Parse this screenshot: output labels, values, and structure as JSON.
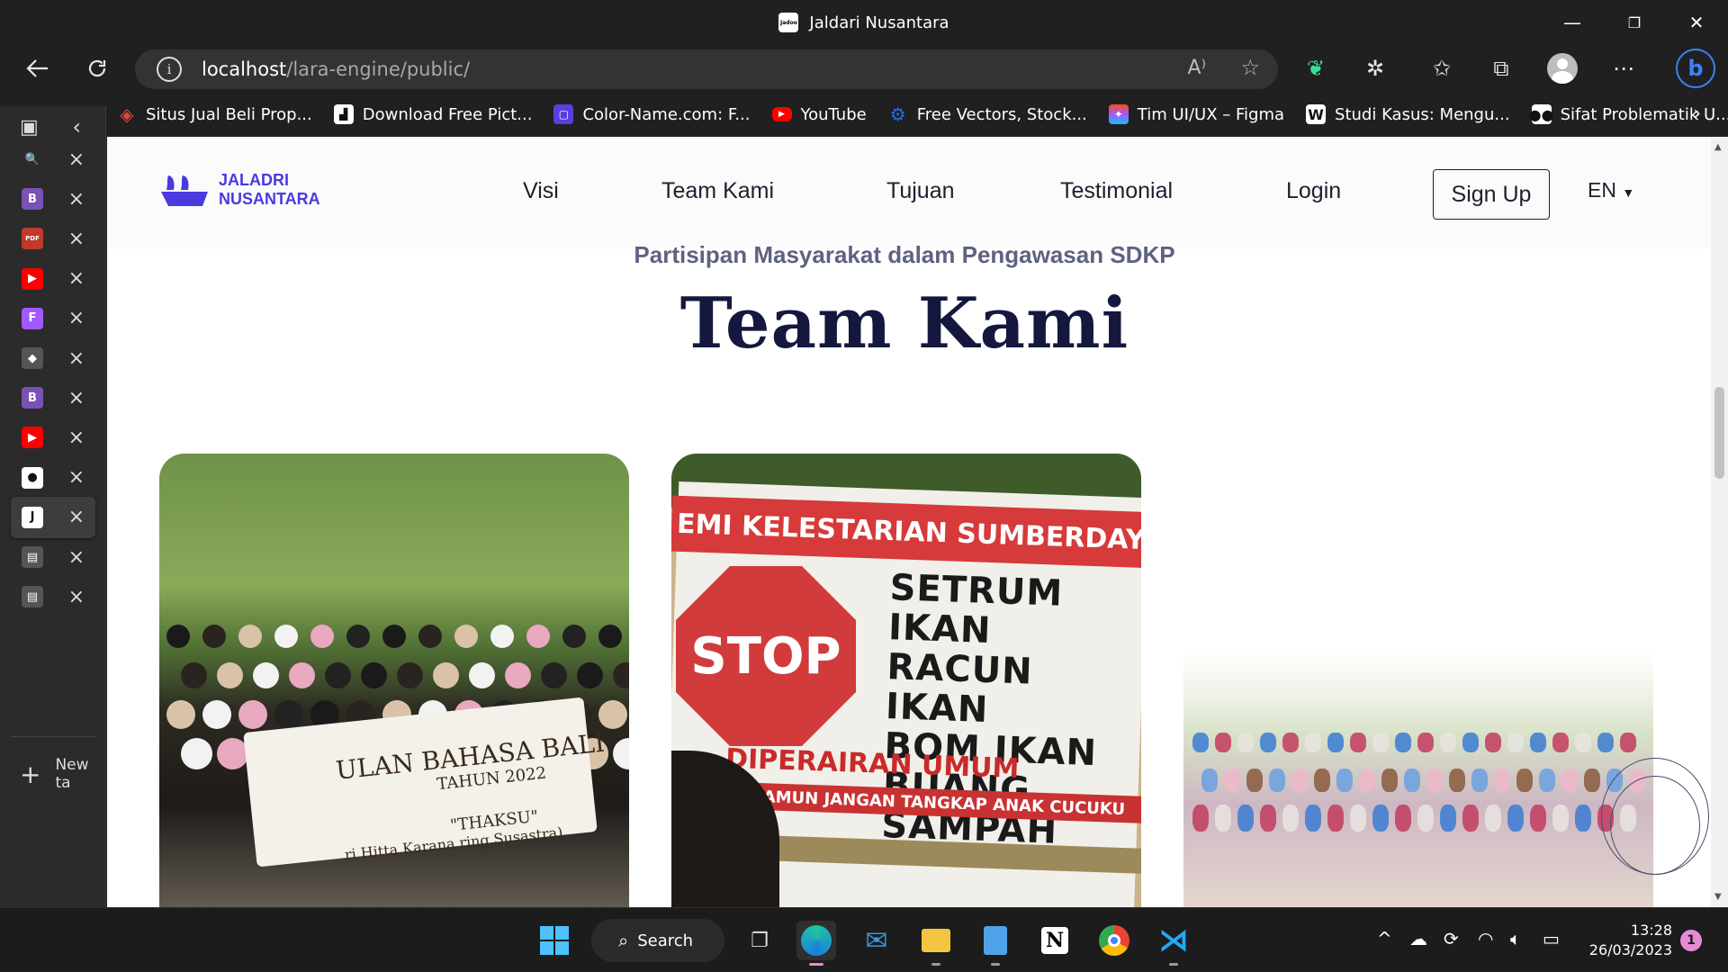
{
  "window": {
    "title": "Jaldari Nusantara",
    "favicon_text": "Jadoo",
    "minimize": "—",
    "maximize": "❐",
    "close": "✕"
  },
  "address_bar": {
    "host": "localhost",
    "path": "/lara-engine/public/"
  },
  "bookmarks": [
    {
      "label": "Situs Jual Beli Prop...",
      "color": "#e2453c",
      "icon": "diamond-icon"
    },
    {
      "label": "Download Free Pict...",
      "color": "#111111",
      "icon": "photo-icon"
    },
    {
      "label": "Color-Name.com: F...",
      "color": "#5b3de0",
      "icon": "square-icon"
    },
    {
      "label": "YouTube",
      "color": "#ff0000",
      "icon": "youtube-icon"
    },
    {
      "label": "Free Vectors, Stock...",
      "color": "#1e6fe8",
      "icon": "gear-icon"
    },
    {
      "label": "Tim UI/UX – Figma",
      "color": "#f24e1e",
      "icon": "figma-icon"
    },
    {
      "label": "Studi Kasus: Mengu...",
      "color": "#111111",
      "icon": "w-icon"
    },
    {
      "label": "Sifat Problematik U...",
      "color": "#ffffff",
      "icon": "medium-icon"
    }
  ],
  "sidebar_tabs": [
    {
      "name": "search-tab",
      "icon": "search-icon",
      "color": "#2b2b2b",
      "glyph": "🔍"
    },
    {
      "name": "bootstrap-tab-1",
      "icon": "bootstrap-icon",
      "color": "#7952b3",
      "glyph": "B"
    },
    {
      "name": "pdf-tab",
      "icon": "pdf-icon",
      "color": "#c0392b",
      "glyph": "PDF"
    },
    {
      "name": "youtube-tab-1",
      "icon": "youtube-icon",
      "color": "#ff0000",
      "glyph": "▶"
    },
    {
      "name": "figma-tab",
      "icon": "figma-icon",
      "color": "#a259ff",
      "glyph": "F"
    },
    {
      "name": "layers-tab",
      "icon": "layers-icon",
      "color": "#555555",
      "glyph": "◆"
    },
    {
      "name": "bootstrap-tab-2",
      "icon": "bootstrap-icon",
      "color": "#7952b3",
      "glyph": "B"
    },
    {
      "name": "youtube-tab-2",
      "icon": "youtube-icon",
      "color": "#ff0000",
      "glyph": "▶"
    },
    {
      "name": "github-tab",
      "icon": "github-icon",
      "color": "#ffffff",
      "glyph": "●"
    },
    {
      "name": "jadoo-tab",
      "icon": "jadoo-icon",
      "color": "#ffffff",
      "glyph": "J",
      "active": true
    },
    {
      "name": "page-tab-1",
      "icon": "page-icon",
      "color": "#555555",
      "glyph": "▤"
    },
    {
      "name": "page-tab-2",
      "icon": "page-icon",
      "color": "#555555",
      "glyph": "▤"
    }
  ],
  "new_tab_label": "New ta",
  "site": {
    "logo_line1": "JALADRI",
    "logo_line2": "NUSANTARA",
    "brand_color": "#4a3adf",
    "nav": [
      "Visi",
      "Team Kami",
      "Tujuan",
      "Testimonial",
      "Login"
    ],
    "signup": "Sign Up",
    "lang": "EN",
    "subtitle": "Partisipan Masyarakat dalam Pengawasan SDKP",
    "heading": "Team Kami"
  },
  "cards": [
    {
      "banner_title": "ULAN BAHASA BALI",
      "banner_year": "TAHUN 2022",
      "banner_sub": "\"THAKSU\"",
      "banner_foot": "ri Hitta Karana ring Susastra)"
    },
    {
      "top": "EMI KELESTARIAN SUMBERDAYA PERIKANA",
      "stop": "STOP",
      "lines": [
        "SETRUM IKAN",
        "RACUN IKAN",
        "BOM IKAN",
        "BUANG SAMPAH"
      ],
      "strip": "DIPERAIRAN UMUM",
      "strip2": "H AKU, NAMUN JANGAN TANGKAP ANAK CUCUKU"
    },
    {}
  ],
  "taskbar": {
    "search_label": "Search",
    "time": "13:28",
    "date": "26/03/2023",
    "notifications": "1"
  }
}
